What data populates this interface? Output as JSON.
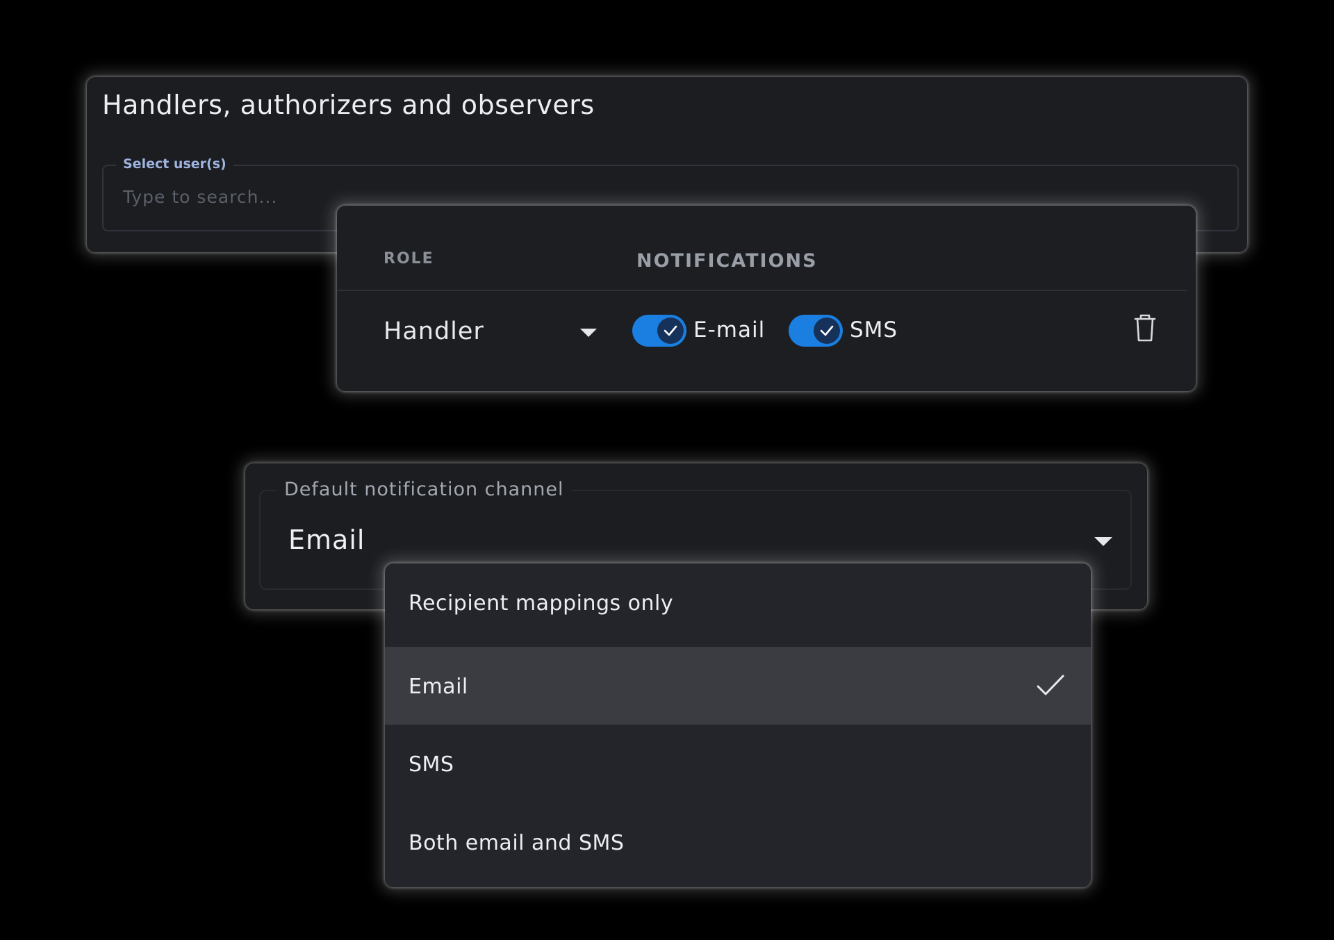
{
  "handlers_panel": {
    "title": "Handlers, authorizers and observers",
    "select_users": {
      "label": "Select user(s)",
      "placeholder": "Type to search..."
    }
  },
  "role_table": {
    "headers": {
      "role": "ROLE",
      "notifications": "NOTIFICATIONS"
    },
    "row": {
      "role": "Handler",
      "email_toggle": {
        "label": "E-mail",
        "checked": true
      },
      "sms_toggle": {
        "label": "SMS",
        "checked": true
      },
      "delete_icon": "trash-icon"
    }
  },
  "default_channel": {
    "label": "Default notification channel",
    "value": "Email"
  },
  "channel_menu": {
    "options": [
      {
        "label": "Recipient mappings only",
        "selected": false
      },
      {
        "label": "Email",
        "selected": true
      },
      {
        "label": "SMS",
        "selected": false
      },
      {
        "label": "Both email and SMS",
        "selected": false
      }
    ]
  },
  "colors": {
    "toggle_on": "#1a7fe0",
    "panel_bg": "#1b1d21",
    "selected_option_bg": "#3a3c42",
    "field_label_accent": "#9fb4e0"
  }
}
